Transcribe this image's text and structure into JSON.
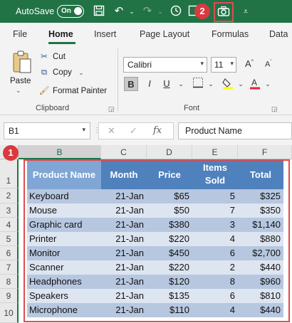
{
  "title_bar": {
    "autosave_label": "AutoSave",
    "autosave_state": "On",
    "icons": [
      "save-icon",
      "undo-icon",
      "redo-icon",
      "clock-icon",
      "camera-icon",
      "customize-icon"
    ]
  },
  "callouts": {
    "one": "1",
    "two": "2"
  },
  "ribbon": {
    "tabs": [
      "File",
      "Home",
      "Insert",
      "Page Layout",
      "Formulas",
      "Data"
    ],
    "active_tab": "Home",
    "clipboard": {
      "paste": "Paste",
      "cut": "Cut",
      "copy": "Copy",
      "format_painter": "Format Painter",
      "group_label": "Clipboard"
    },
    "font": {
      "family": "Calibri",
      "size": "11",
      "group_label": "Font",
      "bold": "B",
      "italic": "I",
      "underline": "U"
    }
  },
  "formula_bar": {
    "name_box": "B1",
    "fx": "fx",
    "cancel": "✕",
    "enter": "✓",
    "content": "Product Name"
  },
  "sheet": {
    "columns": [
      "B",
      "C",
      "D",
      "E",
      "F"
    ],
    "row_numbers": [
      "1",
      "2",
      "3",
      "4",
      "5",
      "6",
      "7",
      "8",
      "9",
      "10"
    ],
    "headers": {
      "product": "Product Name",
      "month": "Month",
      "price": "Price",
      "items_1": "Items",
      "items_2": "Sold",
      "total": "Total"
    },
    "rows": [
      {
        "product": "Keyboard",
        "month": "21-Jan",
        "price": "$65",
        "items": "5",
        "total": "$325"
      },
      {
        "product": "Mouse",
        "month": "21-Jan",
        "price": "$50",
        "items": "7",
        "total": "$350"
      },
      {
        "product": "Graphic card",
        "month": "21-Jan",
        "price": "$380",
        "items": "3",
        "total": "$1,140"
      },
      {
        "product": "Printer",
        "month": "21-Jan",
        "price": "$220",
        "items": "4",
        "total": "$880"
      },
      {
        "product": "Monitor",
        "month": "21-Jan",
        "price": "$450",
        "items": "6",
        "total": "$2,700"
      },
      {
        "product": "Scanner",
        "month": "21-Jan",
        "price": "$220",
        "items": "2",
        "total": "$440"
      },
      {
        "product": "Headphones",
        "month": "21-Jan",
        "price": "$120",
        "items": "8",
        "total": "$960"
      },
      {
        "product": "Speakers",
        "month": "21-Jan",
        "price": "$135",
        "items": "6",
        "total": "$810"
      },
      {
        "product": "Microphone",
        "month": "21-Jan",
        "price": "$110",
        "items": "4",
        "total": "$440"
      }
    ]
  },
  "colors": {
    "excel_green": "#217346",
    "header_blue": "#4f81bd",
    "band_dark": "#b7c7e0",
    "band_light": "#dde5f0",
    "callout_red": "#e04c4c"
  }
}
